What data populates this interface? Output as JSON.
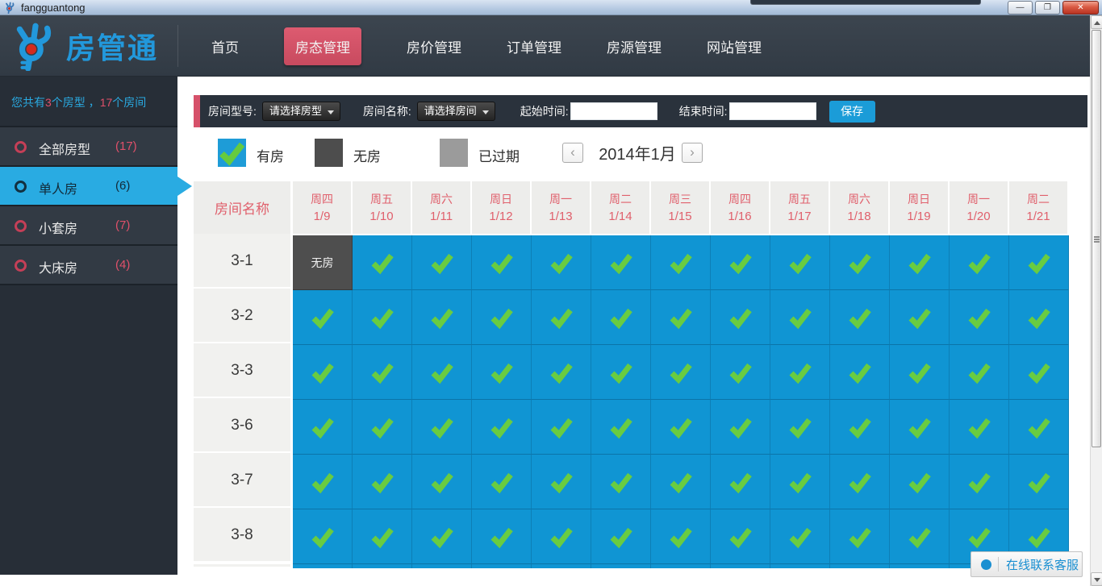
{
  "window": {
    "title": "fangguantong"
  },
  "titlebar": {
    "minimize_icon": "—",
    "restore_icon": "❐",
    "close_icon": "✕"
  },
  "nav": {
    "logo_text": "房管通",
    "items": [
      {
        "label": "首页",
        "active": false
      },
      {
        "label": "房态管理",
        "active": true
      },
      {
        "label": "房价管理",
        "active": false
      },
      {
        "label": "订单管理",
        "active": false
      },
      {
        "label": "房源管理",
        "active": false
      },
      {
        "label": "网站管理",
        "active": false
      }
    ]
  },
  "sidebar": {
    "summary": {
      "prefix": "您共有",
      "type_count": "3",
      "mid": "个房型 ，",
      "room_count": "17",
      "suffix": "个房间"
    },
    "items": [
      {
        "label": "全部房型",
        "count": "(17)",
        "selected": false
      },
      {
        "label": "单人房",
        "count": "(6)",
        "selected": true
      },
      {
        "label": "小套房",
        "count": "(7)",
        "selected": false
      },
      {
        "label": "大床房",
        "count": "(4)",
        "selected": false
      }
    ]
  },
  "filters": {
    "room_type_label": "房间型号:",
    "room_type_value": "请选择房型",
    "room_name_label": "房间名称:",
    "room_name_value": "请选择房间",
    "start_label": "起始时间:",
    "start_value": "",
    "end_label": "结束时间:",
    "end_value": "",
    "save_label": "保存"
  },
  "legend": {
    "items": [
      {
        "label": "有房",
        "type": "available",
        "color": "#1e9cd7"
      },
      {
        "label": "无房",
        "type": "occupied",
        "color": "#4d4d4d"
      },
      {
        "label": "已过期",
        "type": "expired",
        "color": "#9b9b9b"
      }
    ],
    "prev_icon": "‹",
    "next_icon": "›",
    "month": "2014年1月"
  },
  "table": {
    "name_header": "房间名称",
    "none_label": "无房",
    "columns": [
      {
        "weekday": "周四",
        "date": "1/9"
      },
      {
        "weekday": "周五",
        "date": "1/10"
      },
      {
        "weekday": "周六",
        "date": "1/11"
      },
      {
        "weekday": "周日",
        "date": "1/12"
      },
      {
        "weekday": "周一",
        "date": "1/13"
      },
      {
        "weekday": "周二",
        "date": "1/14"
      },
      {
        "weekday": "周三",
        "date": "1/15"
      },
      {
        "weekday": "周四",
        "date": "1/16"
      },
      {
        "weekday": "周五",
        "date": "1/17"
      },
      {
        "weekday": "周六",
        "date": "1/18"
      },
      {
        "weekday": "周日",
        "date": "1/19"
      },
      {
        "weekday": "周一",
        "date": "1/20"
      },
      {
        "weekday": "周二",
        "date": "1/21"
      }
    ],
    "rows": [
      {
        "name": "3-1",
        "cells": [
          "none",
          "check",
          "check",
          "check",
          "check",
          "check",
          "check",
          "check",
          "check",
          "check",
          "check",
          "check",
          "check"
        ]
      },
      {
        "name": "3-2",
        "cells": [
          "check",
          "check",
          "check",
          "check",
          "check",
          "check",
          "check",
          "check",
          "check",
          "check",
          "check",
          "check",
          "check"
        ]
      },
      {
        "name": "3-3",
        "cells": [
          "check",
          "check",
          "check",
          "check",
          "check",
          "check",
          "check",
          "check",
          "check",
          "check",
          "check",
          "check",
          "check"
        ]
      },
      {
        "name": "3-6",
        "cells": [
          "check",
          "check",
          "check",
          "check",
          "check",
          "check",
          "check",
          "check",
          "check",
          "check",
          "check",
          "check",
          "check"
        ]
      },
      {
        "name": "3-7",
        "cells": [
          "check",
          "check",
          "check",
          "check",
          "check",
          "check",
          "check",
          "check",
          "check",
          "check",
          "check",
          "check",
          "check"
        ]
      },
      {
        "name": "3-8",
        "cells": [
          "check",
          "check",
          "check",
          "check",
          "check",
          "check",
          "check",
          "check",
          "check",
          "check",
          "check",
          "check",
          "check"
        ]
      }
    ]
  },
  "service": {
    "label": "在线联系客服"
  },
  "colors": {
    "accent_blue": "#29abe2",
    "cell_blue": "#1095d3",
    "check_green": "#69cc41",
    "active_red": "#d6516a",
    "header_pink": "#e0606c",
    "dark_bg": "#323a44"
  }
}
